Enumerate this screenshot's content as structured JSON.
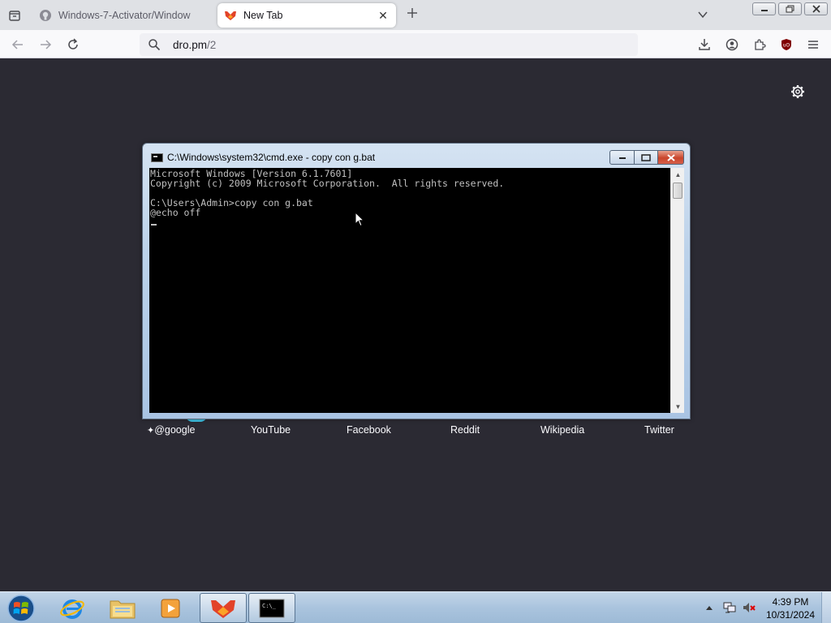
{
  "browser": {
    "tabs": [
      {
        "title": "Windows-7-Activator/Window",
        "active": false,
        "icon": "github-icon"
      },
      {
        "title": "New Tab",
        "active": true,
        "icon": "gitlab-like-fox-icon"
      }
    ],
    "url": {
      "host": "dro.pm",
      "path": "/2"
    }
  },
  "cmd": {
    "title": "C:\\Windows\\system32\\cmd.exe - copy  con g.bat",
    "lines": [
      "Microsoft Windows [Version 6.1.7601]",
      "Copyright (c) 2009 Microsoft Corporation.  All rights reserved.",
      "",
      "C:\\Users\\Admin>copy con g.bat",
      "@echo off"
    ]
  },
  "shortcuts": [
    {
      "label": "@google",
      "pinned": true
    },
    {
      "label": "YouTube"
    },
    {
      "label": "Facebook"
    },
    {
      "label": "Reddit"
    },
    {
      "label": "Wikipedia"
    },
    {
      "label": "Twitter"
    }
  ],
  "taskbar": {
    "time": "4:39 PM",
    "date": "10/31/2024",
    "items": [
      "internet-explorer-icon",
      "file-explorer-icon",
      "media-player-icon",
      "browser-app-icon",
      "cmd-icon"
    ]
  },
  "colors": {
    "page_bg": "#2b2a33",
    "accent": "#3fc1e3"
  }
}
